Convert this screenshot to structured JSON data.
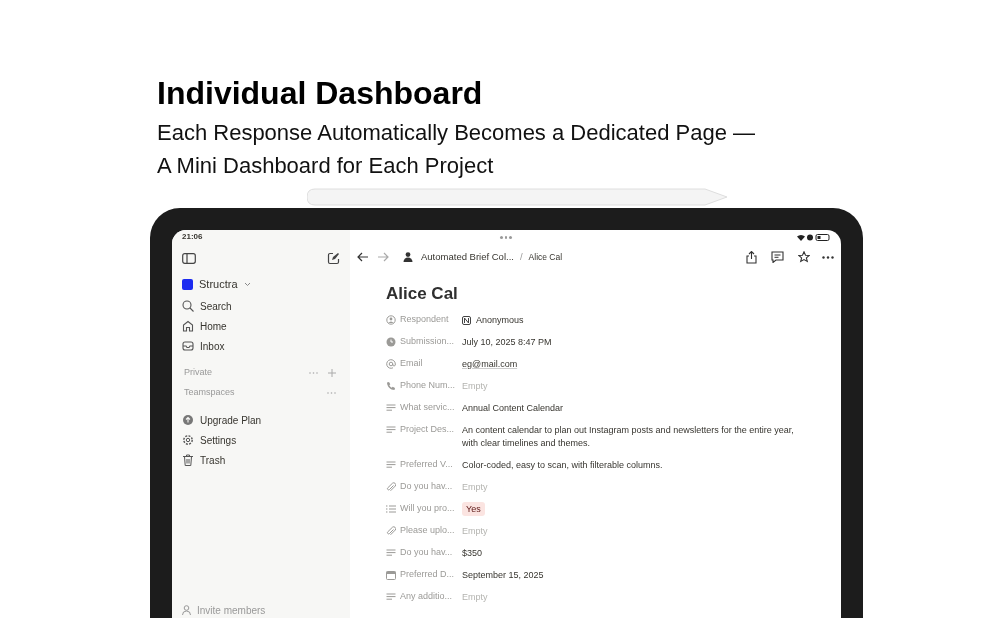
{
  "headline": {
    "title": "Individual Dashboard",
    "subtitle_lines": [
      "Each Response Automatically Becomes a Dedicated Page —",
      "A Mini Dashboard for Each Project"
    ]
  },
  "status_bar": {
    "time": "21:06"
  },
  "sidebar": {
    "workspace": "Structra",
    "items": [
      {
        "kind": "search",
        "label": "Search"
      },
      {
        "kind": "home",
        "label": "Home"
      },
      {
        "kind": "inbox",
        "label": "Inbox"
      }
    ],
    "sections": [
      {
        "label": "Private",
        "addable": true
      },
      {
        "label": "Teamspaces",
        "addable": false
      }
    ],
    "bottom_items": [
      {
        "kind": "upgrade",
        "label": "Upgrade Plan"
      },
      {
        "kind": "settings",
        "label": "Settings"
      },
      {
        "kind": "trash",
        "label": "Trash"
      }
    ],
    "footer": "Invite members"
  },
  "breadcrumb": {
    "separator": "/",
    "items": [
      "Automated Brief Col...",
      "Alice Cal"
    ]
  },
  "page": {
    "title": "Alice Cal",
    "properties": [
      {
        "kind": "person",
        "label": "Respondent",
        "value": "Anonymous",
        "empty": false
      },
      {
        "kind": "created",
        "label": "Submission...",
        "value": "July 10, 2025 8:47 PM",
        "empty": false
      },
      {
        "kind": "email",
        "label": "Email",
        "value": "eg@mail.com",
        "empty": false
      },
      {
        "kind": "phone",
        "label": "Phone Num...",
        "value": "Empty",
        "empty": true
      },
      {
        "kind": "text",
        "label": "What servic...",
        "value": "Annual Content Calendar",
        "empty": false
      },
      {
        "kind": "text",
        "label": "Project Des...",
        "value": "An content calendar to plan out Instagram posts and newsletters for the entire year, with clear timelines and themes.",
        "empty": false
      },
      {
        "kind": "text",
        "label": "Preferred V...",
        "value": "Color-coded, easy to scan, with filterable columns.",
        "empty": false
      },
      {
        "kind": "file",
        "label": "Do you hav...",
        "value": "Empty",
        "empty": true
      },
      {
        "kind": "select",
        "label": "Will you pro...",
        "value": "Yes",
        "empty": false,
        "color": "#fbe4e1"
      },
      {
        "kind": "file",
        "label": "Please uplo...",
        "value": "Empty",
        "empty": true
      },
      {
        "kind": "text",
        "label": "Do you hav...",
        "value": "$350",
        "empty": false
      },
      {
        "kind": "date",
        "label": "Preferred D...",
        "value": "September 15, 2025",
        "empty": false
      },
      {
        "kind": "text",
        "label": "Any additio...",
        "value": "Empty",
        "empty": true
      }
    ]
  }
}
